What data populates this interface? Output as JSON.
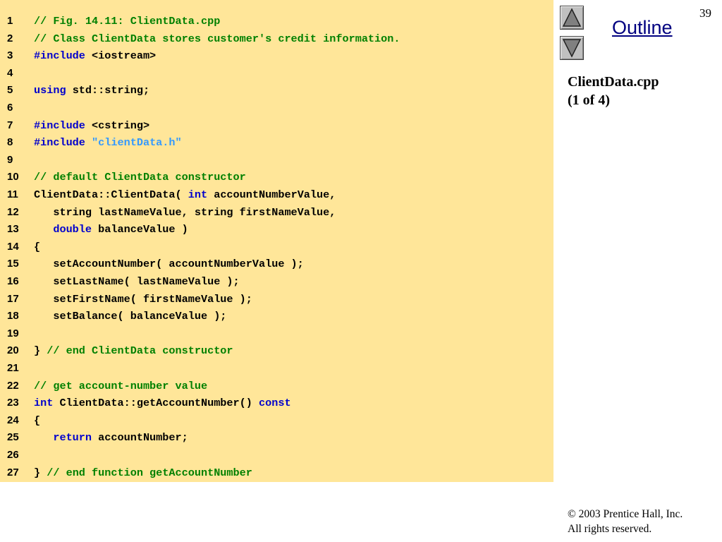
{
  "slide": {
    "page_number": "39",
    "outline_label": "Outline",
    "file_title_line1": "ClientData.cpp",
    "file_title_line2": "(1 of 4)",
    "copyright_line1": "© 2003 Prentice Hall, Inc.",
    "copyright_line2": "All rights reserved."
  },
  "navigation": {
    "up_icon": "triangle-up-icon",
    "down_icon": "triangle-down-icon"
  },
  "colors": {
    "code_background": "#ffe699",
    "comment": "#008000",
    "keyword": "#0000cc",
    "string": "#3399ff",
    "plain": "#000000"
  },
  "code_lines": [
    {
      "num": "1",
      "tokens": [
        {
          "t": "// Fig. 14.11: ClientData.cpp",
          "k": "comment"
        }
      ]
    },
    {
      "num": "2",
      "tokens": [
        {
          "t": "// Class ClientData stores customer's credit information.",
          "k": "comment"
        }
      ]
    },
    {
      "num": "3",
      "tokens": [
        {
          "t": "#include",
          "k": "keyword"
        },
        {
          "t": " <iostream>",
          "k": "plain"
        }
      ]
    },
    {
      "num": "4",
      "tokens": []
    },
    {
      "num": "5",
      "tokens": [
        {
          "t": "using",
          "k": "keyword"
        },
        {
          "t": " std::string;",
          "k": "plain"
        }
      ]
    },
    {
      "num": "6",
      "tokens": []
    },
    {
      "num": "7",
      "tokens": [
        {
          "t": "#include",
          "k": "keyword"
        },
        {
          "t": " <cstring>",
          "k": "plain"
        }
      ]
    },
    {
      "num": "8",
      "tokens": [
        {
          "t": "#include",
          "k": "keyword"
        },
        {
          "t": " ",
          "k": "plain"
        },
        {
          "t": "\"clientData.h\"",
          "k": "string"
        }
      ]
    },
    {
      "num": "9",
      "tokens": []
    },
    {
      "num": "10",
      "tokens": [
        {
          "t": "// default ClientData constructor",
          "k": "comment"
        }
      ]
    },
    {
      "num": "11",
      "tokens": [
        {
          "t": "ClientData::ClientData( ",
          "k": "plain"
        },
        {
          "t": "int",
          "k": "keyword"
        },
        {
          "t": " accountNumberValue,",
          "k": "plain"
        }
      ]
    },
    {
      "num": "12",
      "tokens": [
        {
          "t": "   string lastNameValue, string firstNameValue,",
          "k": "plain"
        }
      ]
    },
    {
      "num": "13",
      "tokens": [
        {
          "t": "   ",
          "k": "plain"
        },
        {
          "t": "double",
          "k": "keyword"
        },
        {
          "t": " balanceValue )",
          "k": "plain"
        }
      ]
    },
    {
      "num": "14",
      "tokens": [
        {
          "t": "{",
          "k": "plain"
        }
      ]
    },
    {
      "num": "15",
      "tokens": [
        {
          "t": "   setAccountNumber( accountNumberValue );",
          "k": "plain"
        }
      ]
    },
    {
      "num": "16",
      "tokens": [
        {
          "t": "   setLastName( lastNameValue );",
          "k": "plain"
        }
      ]
    },
    {
      "num": "17",
      "tokens": [
        {
          "t": "   setFirstName( firstNameValue );",
          "k": "plain"
        }
      ]
    },
    {
      "num": "18",
      "tokens": [
        {
          "t": "   setBalance( balanceValue );",
          "k": "plain"
        }
      ]
    },
    {
      "num": "19",
      "tokens": []
    },
    {
      "num": "20",
      "tokens": [
        {
          "t": "} ",
          "k": "plain"
        },
        {
          "t": "// end ClientData constructor",
          "k": "comment"
        }
      ]
    },
    {
      "num": "21",
      "tokens": []
    },
    {
      "num": "22",
      "tokens": [
        {
          "t": "// get account-number value",
          "k": "comment"
        }
      ]
    },
    {
      "num": "23",
      "tokens": [
        {
          "t": "int",
          "k": "keyword"
        },
        {
          "t": " ClientData::getAccountNumber() ",
          "k": "plain"
        },
        {
          "t": "const",
          "k": "keyword"
        }
      ]
    },
    {
      "num": "24",
      "tokens": [
        {
          "t": "{",
          "k": "plain"
        }
      ]
    },
    {
      "num": "25",
      "tokens": [
        {
          "t": "   ",
          "k": "plain"
        },
        {
          "t": "return",
          "k": "keyword"
        },
        {
          "t": " accountNumber;",
          "k": "plain"
        }
      ]
    },
    {
      "num": "26",
      "tokens": []
    },
    {
      "num": "27",
      "tokens": [
        {
          "t": "} ",
          "k": "plain"
        },
        {
          "t": "// end function getAccountNumber",
          "k": "comment"
        }
      ]
    }
  ]
}
